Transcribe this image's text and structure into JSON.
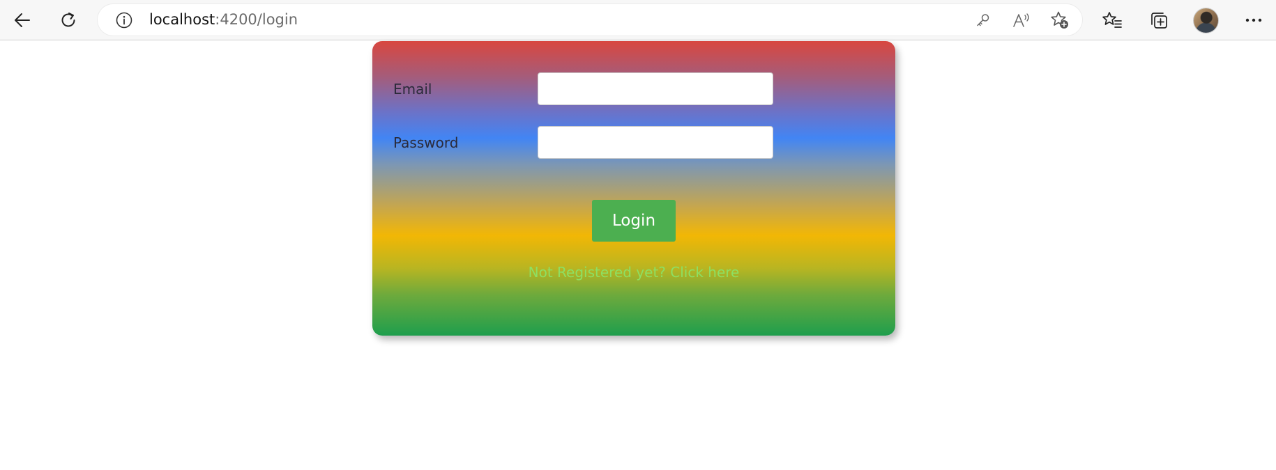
{
  "browser": {
    "url_host": "localhost",
    "url_rest": ":4200/login",
    "icons": {
      "back": "back-arrow-icon",
      "refresh": "refresh-icon",
      "info": "info-icon",
      "key": "key-icon",
      "read_aloud": "read-aloud-icon",
      "add_favorite": "add-favorite-icon",
      "favorites": "favorites-icon",
      "collections": "collections-icon",
      "profile": "profile-avatar",
      "more": "more-options-icon"
    }
  },
  "login": {
    "email_label": "Email",
    "email_value": "",
    "password_label": "Password",
    "password_value": "",
    "login_button": "Login",
    "register_link": "Not Registered yet? Click here"
  },
  "colors": {
    "button": "#4caf50",
    "link": "#8de063",
    "gradient_top": "#d9473f",
    "gradient_blue": "#4285f4",
    "gradient_yellow": "#f2b705",
    "gradient_bottom": "#1e9e4d"
  }
}
